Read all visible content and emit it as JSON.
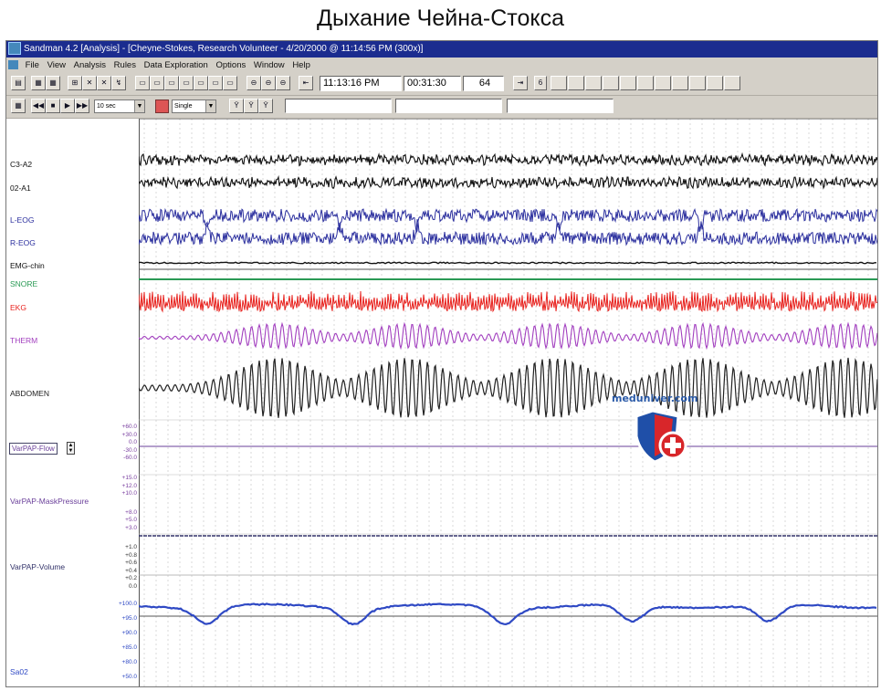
{
  "caption": "Дыхание Чейна-Стокса",
  "window": {
    "title": "Sandman 4.2 [Analysis] - [Cheyne-Stokes, Research Volunteer - 4/20/2000 @ 11:14:56 PM (300x)]"
  },
  "menu": [
    "File",
    "View",
    "Analysis",
    "Rules",
    "Data Exploration",
    "Options",
    "Window",
    "Help"
  ],
  "toolbar": {
    "clock_time": "11:13:16 PM",
    "elapsed": "00:31:30",
    "epoch": "64",
    "page_button": "6",
    "timebase_select": "10 sec",
    "mode_select": "Single"
  },
  "channels": [
    {
      "label": "C3-A2",
      "color": "#111111"
    },
    {
      "label": "02-A1",
      "color": "#111111"
    },
    {
      "label": "L-EOG",
      "color": "#2b2f9e"
    },
    {
      "label": "R-EOG",
      "color": "#2b2f9e"
    },
    {
      "label": "EMG-chin",
      "color": "#111111"
    },
    {
      "label": "SNORE",
      "color": "#2a9a55"
    },
    {
      "label": "EKG",
      "color": "#e8231f"
    },
    {
      "label": "THERM",
      "color": "#a23fbf"
    },
    {
      "label": "ABDOMEN",
      "color": "#222222"
    },
    {
      "label": "VarPAP-Flow",
      "color": "#6a3f9a"
    },
    {
      "label": "VarPAP-MaskPressure",
      "color": "#6a3f9a"
    },
    {
      "label": "VarPAP-Volume",
      "color": "#33336a"
    },
    {
      "label": "Sa02",
      "color": "#2f49c4"
    }
  ],
  "scales": {
    "flow": [
      "+60.0",
      "+30.0",
      "0.0",
      "-30.0",
      "-60.0"
    ],
    "mask": [
      "+15.0",
      "+12.0",
      "+10.0",
      "+8.0",
      "+5.0",
      "+3.0"
    ],
    "volume": [
      "+1.0",
      "+0.8",
      "+0.6",
      "+0.4",
      "+0.2",
      "0.0"
    ],
    "sao2": [
      "+100.0",
      "+95.0",
      "+90.0",
      "+85.0",
      "+80.0",
      "+50.0"
    ]
  },
  "watermark": "meduniver.com"
}
